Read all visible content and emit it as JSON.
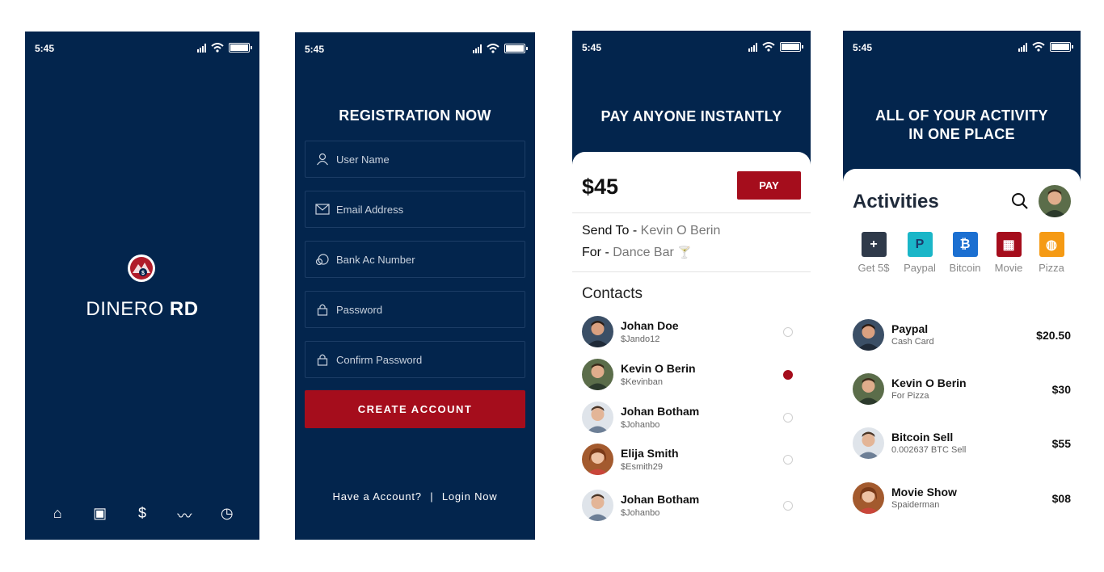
{
  "status": {
    "time": "5:45"
  },
  "screen1": {
    "brand_light": "DINERO ",
    "brand_bold": "RD",
    "nav": [
      {
        "icon": "home-icon",
        "glyph": "⌂"
      },
      {
        "icon": "wallet-icon",
        "glyph": "▣"
      },
      {
        "icon": "dollar-icon",
        "glyph": "$"
      },
      {
        "icon": "stats-icon",
        "glyph": "〰"
      },
      {
        "icon": "clock-icon",
        "glyph": "◷"
      }
    ]
  },
  "screen2": {
    "title": "REGISTRATION NOW",
    "fields": [
      {
        "placeholder": "User Name",
        "icon": "user-icon"
      },
      {
        "placeholder": "Email Address",
        "icon": "mail-icon"
      },
      {
        "placeholder": "Bank Ac Number",
        "icon": "bank-icon"
      },
      {
        "placeholder": "Password",
        "icon": "lock-icon"
      },
      {
        "placeholder": "Confirm Password",
        "icon": "lock-icon"
      }
    ],
    "create_label": "CREATE ACCOUNT",
    "have_account": "Have a Account?",
    "separator": "|",
    "login_label": "Login Now"
  },
  "screen3": {
    "title": "PAY ANYONE INSTANTLY",
    "amount": "$45",
    "pay_label": "PAY",
    "send_to_label": "Send To -",
    "send_to_value": "Kevin O Berin",
    "for_label": "For -",
    "for_value": "Dance Bar",
    "for_emoji": "🍸",
    "contacts_heading": "Contacts",
    "contacts": [
      {
        "name": "Johan Doe",
        "handle": "$Jando12",
        "selected": false
      },
      {
        "name": "Kevin O Berin",
        "handle": "$Kevinban",
        "selected": true
      },
      {
        "name": "Johan Botham",
        "handle": "$Johanbo",
        "selected": false
      },
      {
        "name": "Elija Smith",
        "handle": "$Esmith29",
        "selected": false
      },
      {
        "name": "Johan Botham",
        "handle": "$Johanbo",
        "selected": false
      }
    ]
  },
  "screen4": {
    "title_line1": "ALL OF YOUR ACTIVITY",
    "title_line2": "IN ONE PLACE",
    "heading": "Activities",
    "quick": [
      {
        "label": "Get 5$",
        "glyph": "+",
        "color": "#2f3a4a"
      },
      {
        "label": "Paypal",
        "glyph": "P",
        "color": "#1ab6c8"
      },
      {
        "label": "Bitcoin",
        "glyph": "₿",
        "color": "#1b6fd1"
      },
      {
        "label": "Movie",
        "glyph": "▦",
        "color": "#a50d1c"
      },
      {
        "label": "Pizza",
        "glyph": "◍",
        "color": "#f59a14"
      }
    ],
    "activities": [
      {
        "title": "Paypal",
        "sub": "Cash Card",
        "amount": "$20.50"
      },
      {
        "title": "Kevin O Berin",
        "sub": "For Pizza",
        "amount": "$30"
      },
      {
        "title": "Bitcoin Sell",
        "sub": "0.002637 BTC Sell",
        "amount": "$55"
      },
      {
        "title": "Movie Show",
        "sub": "Spaiderman",
        "amount": "$08"
      }
    ]
  }
}
